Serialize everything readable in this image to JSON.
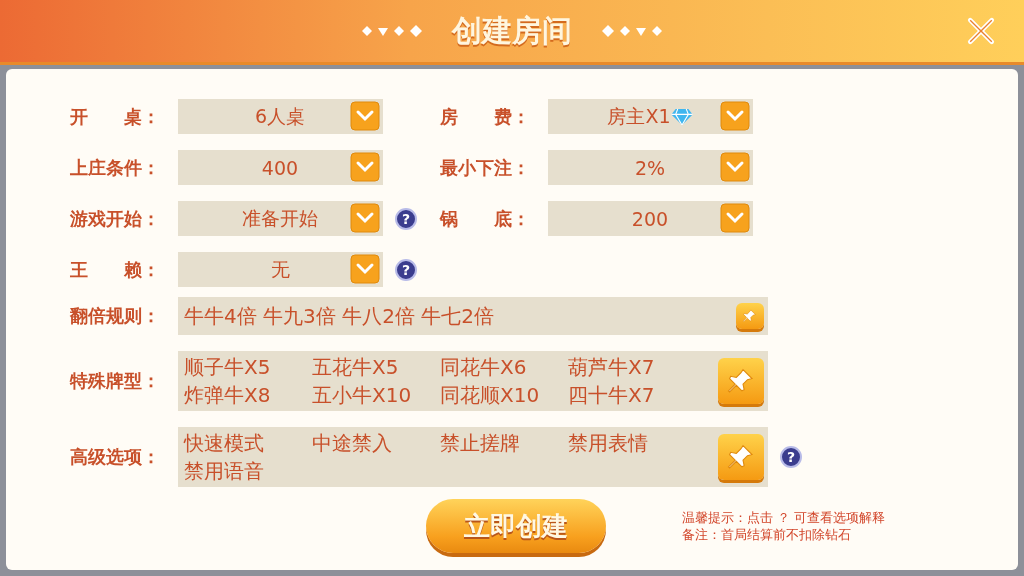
{
  "header": {
    "title": "创建房间"
  },
  "selects": [
    {
      "label": "开　　桌：",
      "value": "6人桌",
      "gem": false
    },
    {
      "label": "房　　费：",
      "value": "房主X1",
      "gem": true
    },
    {
      "label": "上庄条件：",
      "value": "400",
      "gem": false
    },
    {
      "label": "最小下注：",
      "value": "2%",
      "gem": false
    },
    {
      "label": "游戏开始：",
      "value": "准备开始",
      "gem": false,
      "help": "?"
    },
    {
      "label": "锅　　底：",
      "value": "200",
      "gem": false
    },
    {
      "label": "王　　赖：",
      "value": "无",
      "gem": false,
      "help": "?"
    }
  ],
  "rules": [
    {
      "label": "翻倍规则：",
      "kind": "line",
      "items": [
        "牛牛4倍 牛九3倍 牛八2倍 牛七2倍"
      ]
    },
    {
      "label": "特殊牌型：",
      "kind": "grid",
      "items": [
        "顺子牛X5",
        "五花牛X5",
        "同花牛X6",
        "葫芦牛X7",
        "炸弹牛X8",
        "五小牛X10",
        "同花顺X10",
        "四十牛X7"
      ]
    },
    {
      "label": "高级选项：",
      "kind": "grid",
      "items": [
        "快速模式",
        "中途禁入",
        "禁止搓牌",
        "禁用表情",
        "禁用语音"
      ],
      "help": "?"
    }
  ],
  "create_button": "立即创建",
  "notes": [
    "温馨提示：点击 ？ 可查看选项解释",
    "备注：首局结算前不扣除钻石"
  ]
}
